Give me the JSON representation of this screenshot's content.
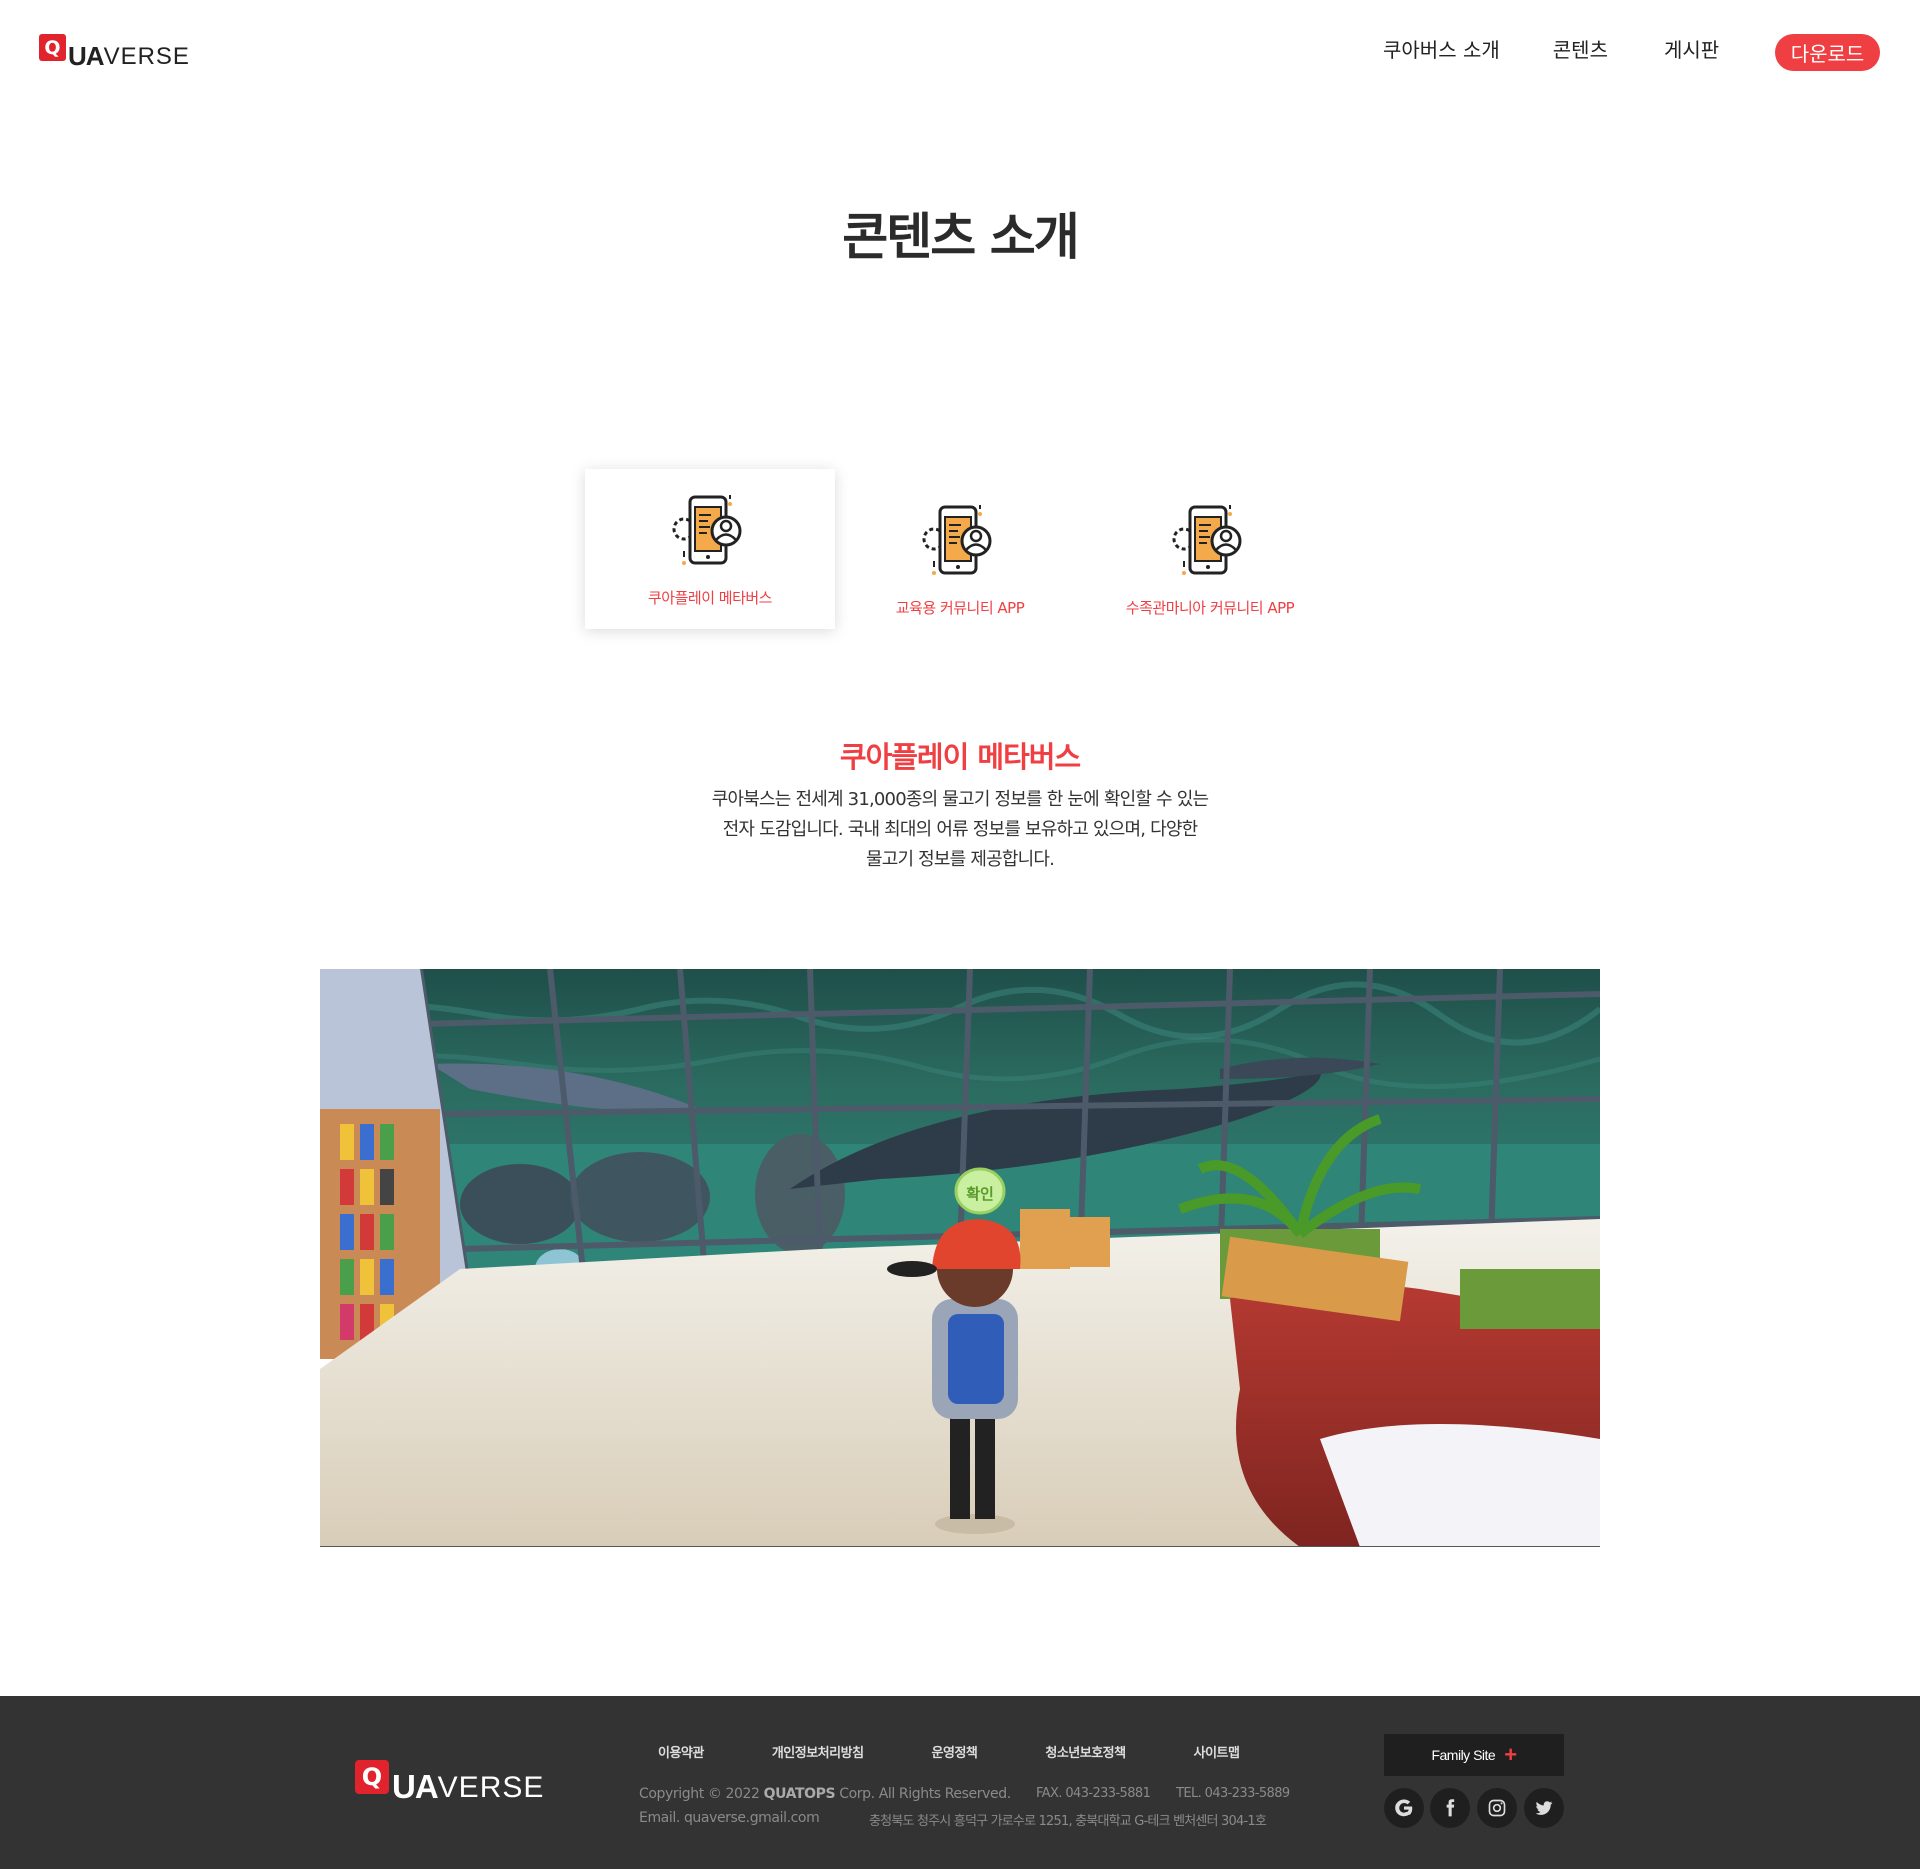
{
  "header": {
    "logo": {
      "q": "Q",
      "ua": "UA",
      "verse": "VERSE"
    },
    "nav": [
      "쿠아버스 소개",
      "콘텐츠",
      "게시판"
    ],
    "download_label": "다운로드"
  },
  "page_title": "콘텐츠 소개",
  "tabs": [
    {
      "label": "쿠아플레이 메타버스",
      "active": true
    },
    {
      "label": "교육용  커뮤니티 APP",
      "active": false
    },
    {
      "label": "수족관마니아  커뮤니티 APP",
      "active": false
    }
  ],
  "section": {
    "title": "쿠아플레이 메타버스",
    "desc_lines": [
      "쿠아북스는 전세계 31,000종의 물고기 정보를 한 눈에 확인할 수 있는",
      "전자 도감입니다. 국내 최대의  어류 정보를 보유하고 있으며, 다양한",
      "물고기 정보를 제공합니다."
    ]
  },
  "scene": {
    "sign_text": "확인"
  },
  "footer": {
    "logo": {
      "q": "Q",
      "ua": "UA",
      "verse": "VERSE"
    },
    "links": [
      "이용약관",
      "개인정보처리방침",
      "운영정책",
      "청소년보호정책",
      "사이트맵"
    ],
    "copyright_prefix": "Copyright © 2022 ",
    "copyright_company": "QUATOPS",
    "copyright_suffix": " Corp. All Rights Reserved.",
    "fax": "FAX. 043-233-5881",
    "tel": "TEL. 043-233-5889",
    "email": "Email. quaverse.gmail.com",
    "address": "충청북도 청주시 흥덕구 가로수로 1251, 충북대학교 G-테크 벤처센터 304-1호",
    "family_site_label": "Family Site",
    "family_site_plus": "+",
    "social_icons": [
      "google-icon",
      "facebook-icon",
      "instagram-icon",
      "twitter-icon"
    ]
  },
  "colors": {
    "accent": "#ef3f43",
    "brand_red": "#e0232d",
    "footer_bg": "#333333"
  }
}
